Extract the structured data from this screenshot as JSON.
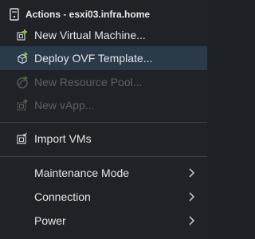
{
  "header": {
    "title": "Actions - esxi03.infra.home",
    "icon": "host-server-icon"
  },
  "items": [
    {
      "label": "New Virtual Machine...",
      "icon": "new-vm-icon",
      "enabled": true
    },
    {
      "label": "Deploy OVF Template...",
      "icon": "deploy-ovf-icon",
      "enabled": true,
      "highlighted": true
    },
    {
      "label": "New Resource Pool...",
      "icon": "resource-pool-icon",
      "enabled": false
    },
    {
      "label": "New vApp...",
      "icon": "new-vapp-icon",
      "enabled": false
    },
    {
      "label": "Import VMs",
      "icon": "import-vms-icon",
      "enabled": true
    },
    {
      "label": "Maintenance Mode",
      "submenu": true,
      "enabled": true
    },
    {
      "label": "Connection",
      "submenu": true,
      "enabled": true
    },
    {
      "label": "Power",
      "submenu": true,
      "enabled": true
    }
  ],
  "colors": {
    "background": "#1f2327",
    "highlight": "#2b3a48",
    "text": "#e4e6e8",
    "disabled_text": "#5a6066",
    "accent_green": "#7ec242",
    "divider": "#3c4248"
  }
}
